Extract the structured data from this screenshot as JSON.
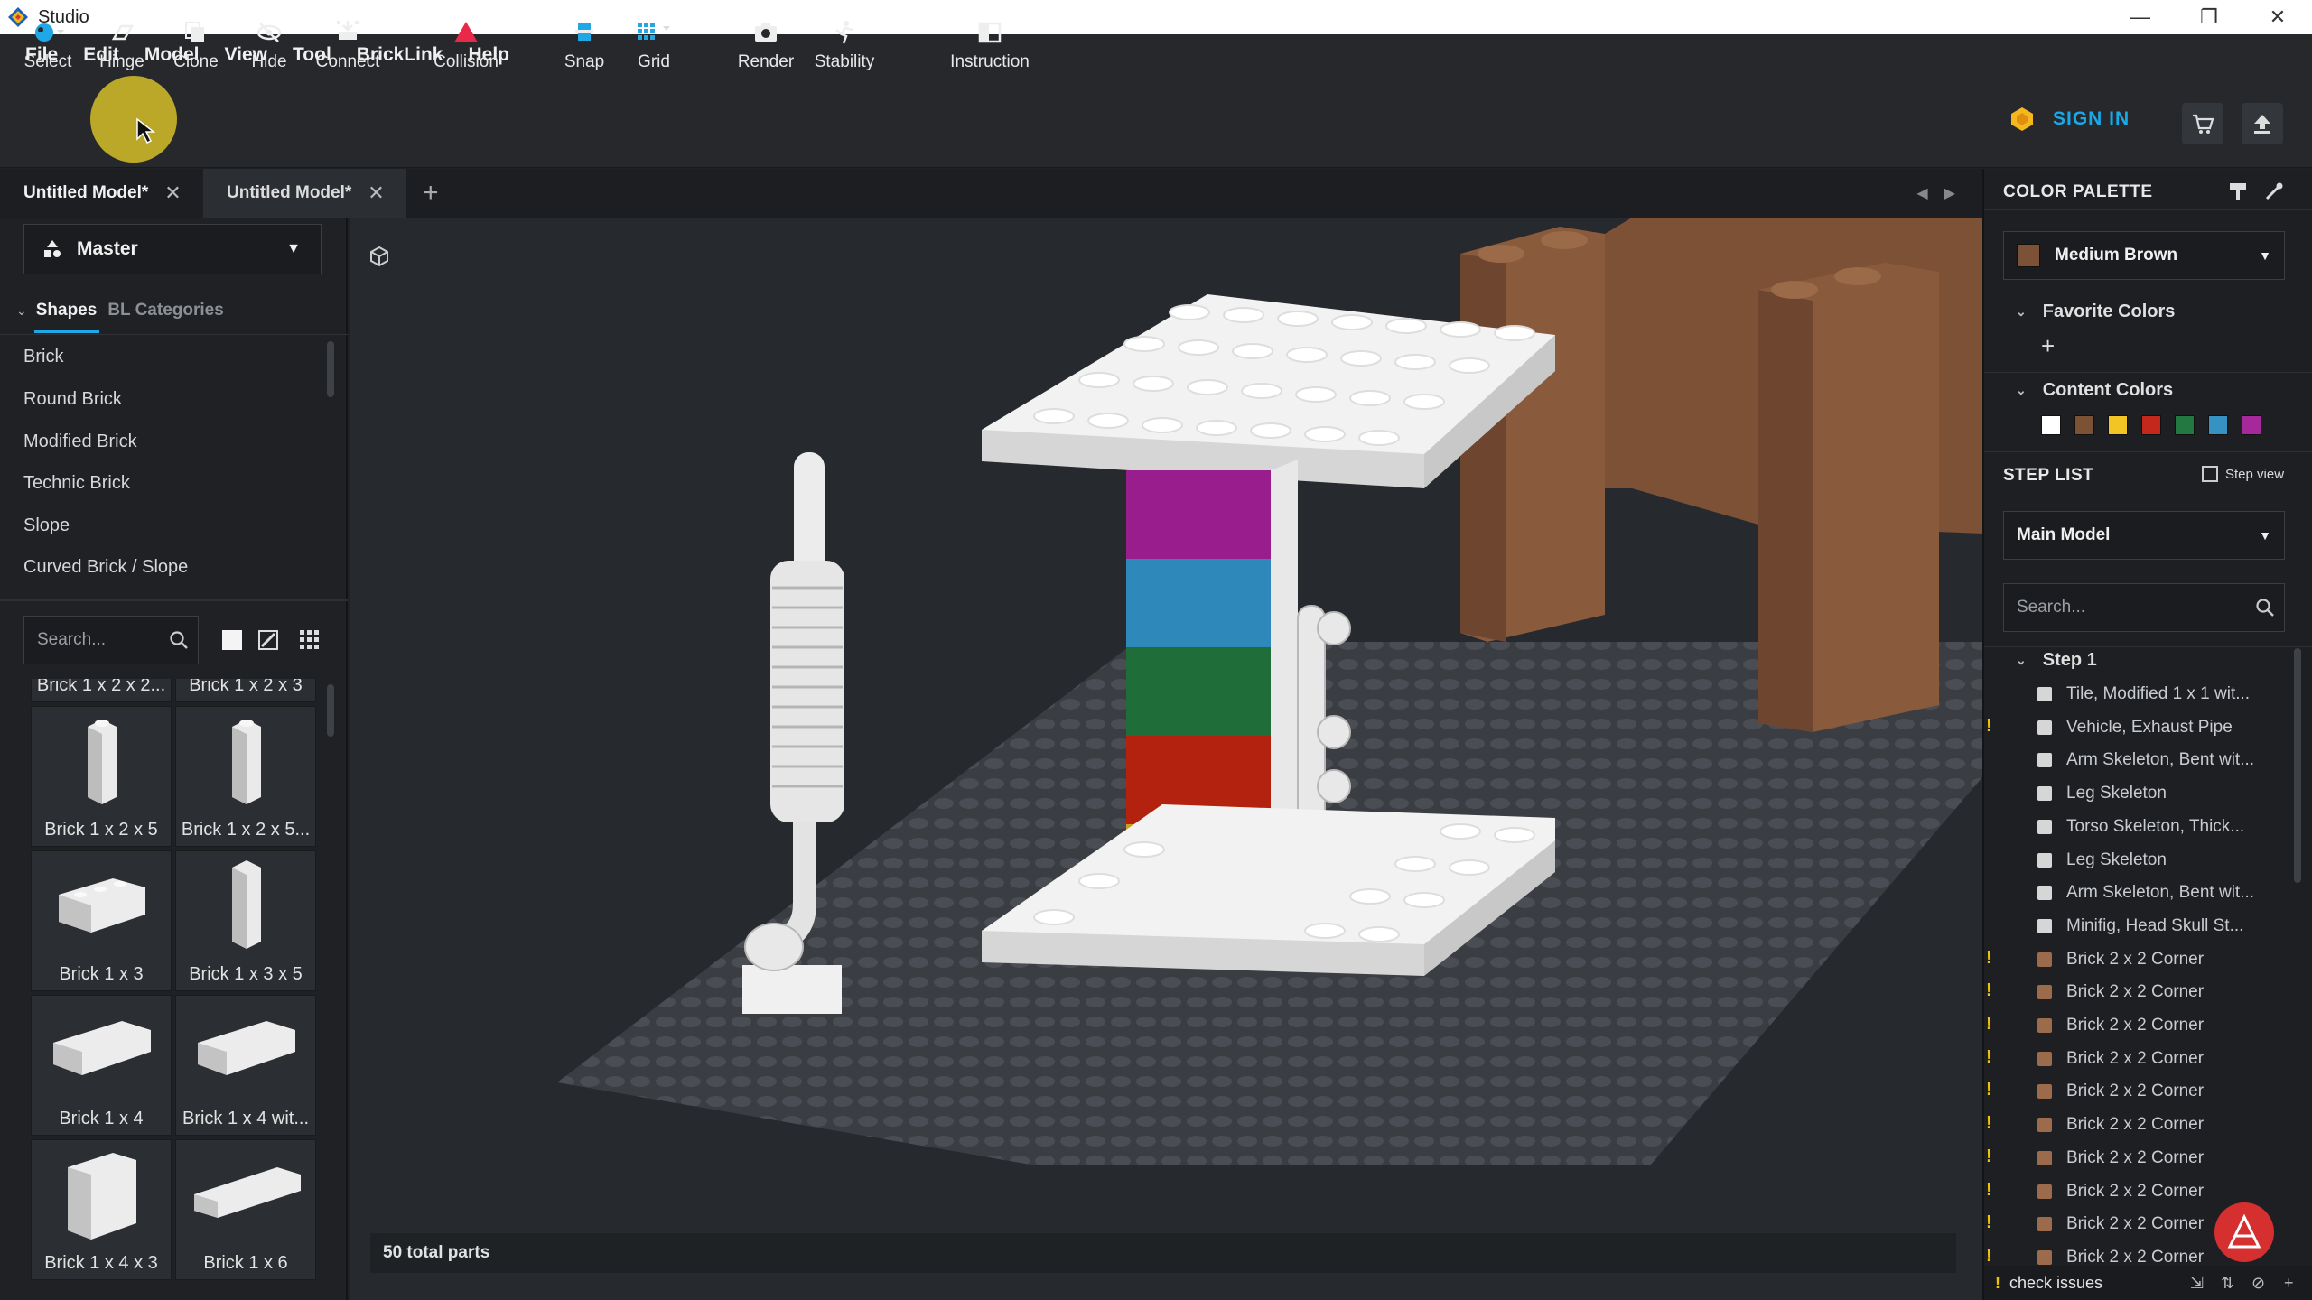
{
  "window": {
    "title": "Studio",
    "minimize": "—",
    "restore": "❐",
    "close": "✕"
  },
  "menu": [
    "File",
    "Edit",
    "Model",
    "View",
    "Tool",
    "BrickLink",
    "Help"
  ],
  "toolbar": {
    "select": "Select",
    "hinge": "Hinge",
    "clone": "Clone",
    "hide": "Hide",
    "connect": "Connect",
    "collision": "Collision",
    "snap": "Snap",
    "grid": "Grid",
    "render": "Render",
    "stability": "Stability",
    "instruction": "Instruction",
    "sign_in": "SIGN IN"
  },
  "tabs": [
    {
      "label": "Untitled Model*"
    },
    {
      "label": "Untitled Model*"
    }
  ],
  "left": {
    "master": "Master",
    "shapes_tab": "Shapes",
    "bl_tab": "BL Categories",
    "categories": [
      "Brick",
      "Round Brick",
      "Modified Brick",
      "Technic Brick",
      "Slope",
      "Curved Brick / Slope"
    ],
    "search_placeholder": "Search...",
    "bricks": [
      "Brick 1 x 2 x 2...",
      "Brick 1 x 2 x 3",
      "Brick 1 x 2 x 5",
      "Brick 1 x 2 x 5...",
      "Brick 1 x 3",
      "Brick 1 x 3 x 5",
      "Brick 1 x 4",
      "Brick 1 x 4 wit...",
      "Brick 1 x 4 x 3",
      "Brick 1 x 6"
    ]
  },
  "viewport": {
    "part_count": "50 total parts"
  },
  "right": {
    "color_palette": "COLOR PALETTE",
    "selected_color": "Medium Brown",
    "selected_color_hex": "#7b5236",
    "favorite_colors": "Favorite Colors",
    "add": "+",
    "content_colors": "Content Colors",
    "content_swatches": [
      "#ffffff",
      "#7b5236",
      "#f3c524",
      "#c4281c",
      "#237841",
      "#3592c3",
      "#a5299b"
    ],
    "step_list": "STEP LIST",
    "step_view": "Step view",
    "main_model": "Main Model",
    "search_placeholder": "Search...",
    "step1": "Step 1",
    "steps": [
      {
        "label": "Tile, Modified 1 x 1 wit...",
        "warn": false
      },
      {
        "label": "Vehicle, Exhaust Pipe",
        "warn": true
      },
      {
        "label": "Arm Skeleton, Bent wit...",
        "warn": false
      },
      {
        "label": "Leg Skeleton",
        "warn": false
      },
      {
        "label": "Torso Skeleton, Thick...",
        "warn": false
      },
      {
        "label": "Leg Skeleton",
        "warn": false
      },
      {
        "label": "Arm Skeleton, Bent wit...",
        "warn": false
      },
      {
        "label": "Minifig, Head Skull St...",
        "warn": false
      },
      {
        "label": "Brick 2 x 2 Corner",
        "warn": true
      },
      {
        "label": "Brick 2 x 2 Corner",
        "warn": true
      },
      {
        "label": "Brick 2 x 2 Corner",
        "warn": true
      },
      {
        "label": "Brick 2 x 2 Corner",
        "warn": true
      },
      {
        "label": "Brick 2 x 2 Corner",
        "warn": true
      },
      {
        "label": "Brick 2 x 2 Corner",
        "warn": true
      },
      {
        "label": "Brick 2 x 2 Corner",
        "warn": true
      },
      {
        "label": "Brick 2 x 2 Corner",
        "warn": true
      },
      {
        "label": "Brick 2 x 2 Corner",
        "warn": true
      },
      {
        "label": "Brick 2 x 2 Corner",
        "warn": true
      }
    ],
    "check_issues": "check issues",
    "warn_mark": "!"
  }
}
